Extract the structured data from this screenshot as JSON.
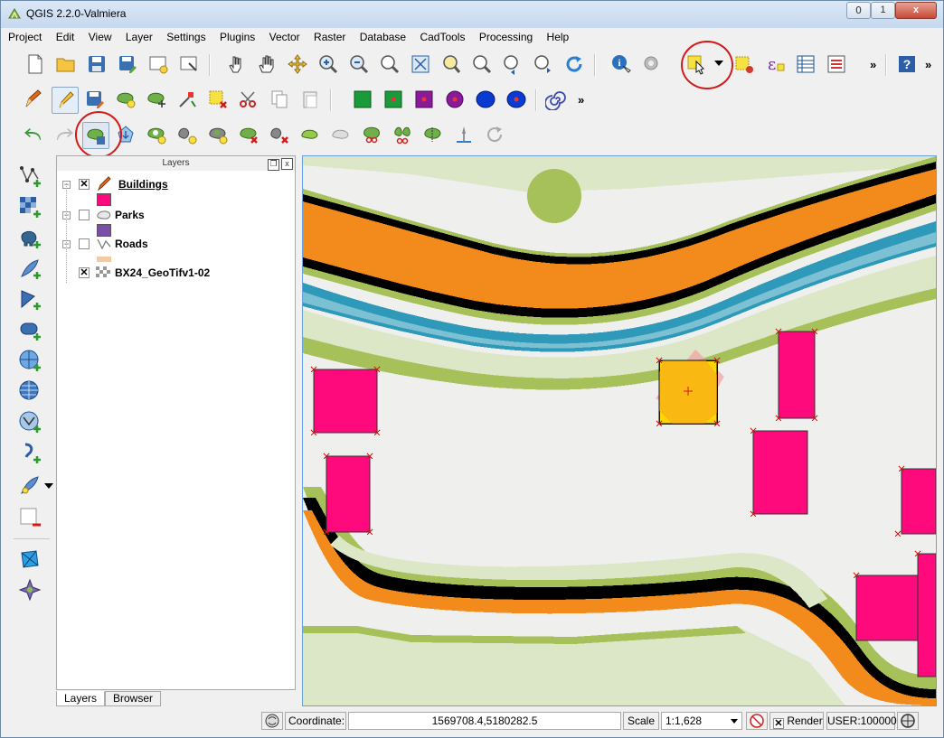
{
  "window": {
    "title": "QGIS 2.2.0-Valmiera",
    "controls": {
      "minimize": "0",
      "maximize": "1",
      "close": "x"
    }
  },
  "menu": [
    "Project",
    "Edit",
    "View",
    "Layer",
    "Settings",
    "Plugins",
    "Vector",
    "Raster",
    "Database",
    "CadTools",
    "Processing",
    "Help"
  ],
  "toolbar": {
    "more1": "»",
    "more2": "»",
    "more3": "»"
  },
  "layers_panel": {
    "title": "Layers",
    "dock_float": "❐",
    "dock_close": "x",
    "layers": [
      {
        "name": "Buildings",
        "checked": true,
        "editing": true,
        "color": "#ff0a7c"
      },
      {
        "name": "Parks",
        "checked": false,
        "color": "#7a4fa8"
      },
      {
        "name": "Roads",
        "checked": false,
        "color": "#f7c99c"
      },
      {
        "name": "BX24_GeoTifv1-02",
        "checked": true
      }
    ]
  },
  "tabs": [
    "Layers",
    "Browser"
  ],
  "status": {
    "coordinate_label": "Coordinate:",
    "coordinate_value": "1569708.4,5180282.5",
    "scale_label": "Scale",
    "scale_value": "1:1,628",
    "render_label": "Render",
    "crs": "USER:100000"
  },
  "colors": {
    "road_orange": "#f28a1c",
    "road_black": "#000000",
    "grass_green": "#a7c15a",
    "light_green": "#dce7c8",
    "water_blue": "#1a8fb4",
    "building_pink": "#ff0a7c",
    "selected_yellow": "#ffd700",
    "highlight_ring": "#d21a1a"
  }
}
